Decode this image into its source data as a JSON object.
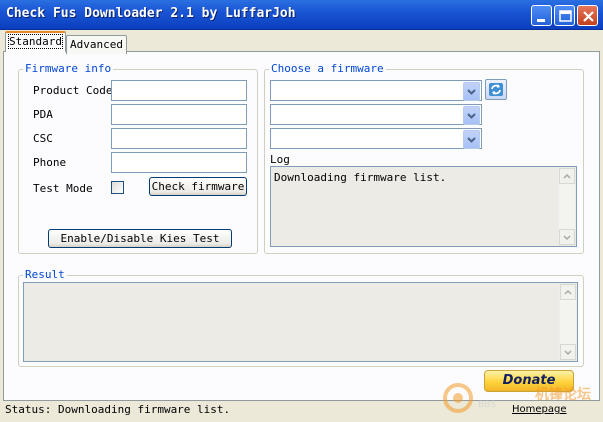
{
  "window": {
    "title": "Check Fus Downloader 2.1 by LuffarJoh"
  },
  "tabs": [
    {
      "label": "Standard",
      "active": true
    },
    {
      "label": "Advanced",
      "active": false
    }
  ],
  "firmware_info": {
    "legend": "Firmware info",
    "fields": [
      {
        "label": "Product Code",
        "value": ""
      },
      {
        "label": "PDA",
        "value": ""
      },
      {
        "label": "CSC",
        "value": ""
      },
      {
        "label": "Phone",
        "value": ""
      }
    ],
    "test_mode_label": "Test Mode",
    "test_mode_checked": false,
    "check_firmware_label": "Check firmware",
    "kies_test_label": "Enable/Disable Kies Test"
  },
  "choose_firmware": {
    "legend": "Choose a firmware",
    "selects": [
      "",
      "",
      ""
    ],
    "log_label": "Log",
    "log_text": "Downloading firmware list."
  },
  "result": {
    "legend": "Result",
    "text": ""
  },
  "footer": {
    "donate_label": "Donate",
    "homepage_label": "Homepage",
    "status_text": "Status: Downloading firmware list."
  },
  "watermark": {
    "text": "BBS",
    "brand": "机锋论坛"
  },
  "colors": {
    "titlebar": "#1a55d6",
    "legend": "#0046d5",
    "window_bg": "#ece9d8",
    "donate": "#ffd33c"
  }
}
